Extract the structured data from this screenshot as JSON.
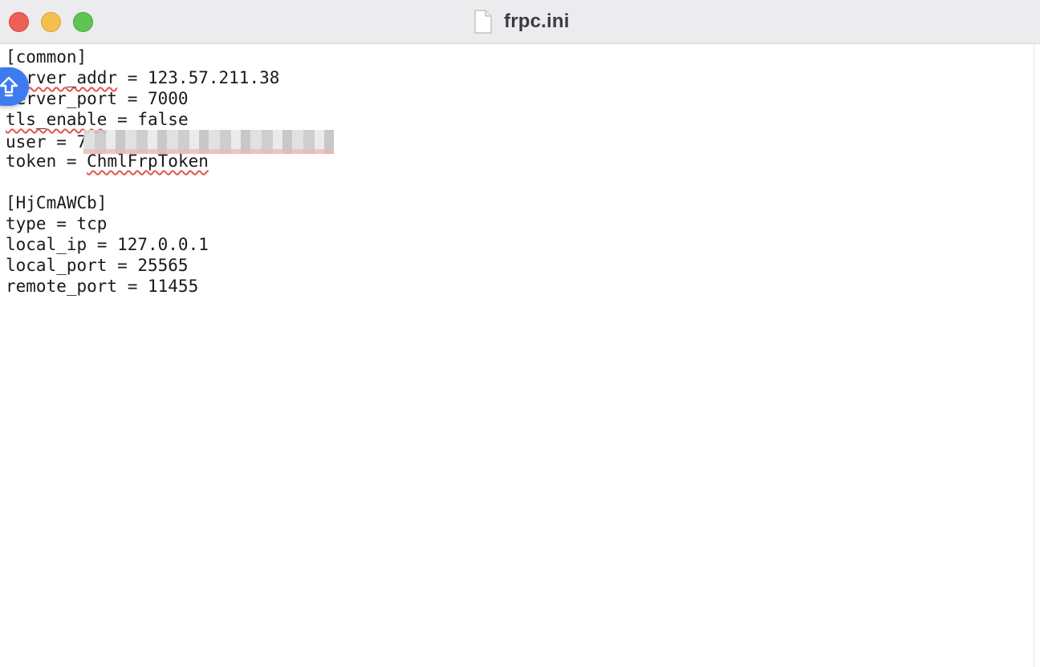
{
  "window": {
    "title": "frpc.ini"
  },
  "editor": {
    "lines": {
      "l1": "[common]",
      "l2a": "server_addr",
      "l2b": " = 123.57.211.38",
      "l3": "server_port = 7000",
      "l4a": "tls_enable",
      "l4b": " = false",
      "l5a": "user = 7",
      "l6a": "token = ",
      "l6b": "ChmlFrpToken",
      "l7": "",
      "l8": "[HjCmAWCb]",
      "l9": "type = tcp",
      "l10": "local_ip = 127.0.0.1",
      "l11": "local_port = 25565",
      "l12": "remote_port = 11455"
    }
  },
  "icons": {
    "document": "document-icon",
    "floating": "upload-arrow-icon"
  },
  "colors": {
    "close": "#ed5f57",
    "minimize": "#f4bf4f",
    "zoom": "#5fc454",
    "accent": "#3d7cf0",
    "spellcheck": "#e5534b"
  }
}
